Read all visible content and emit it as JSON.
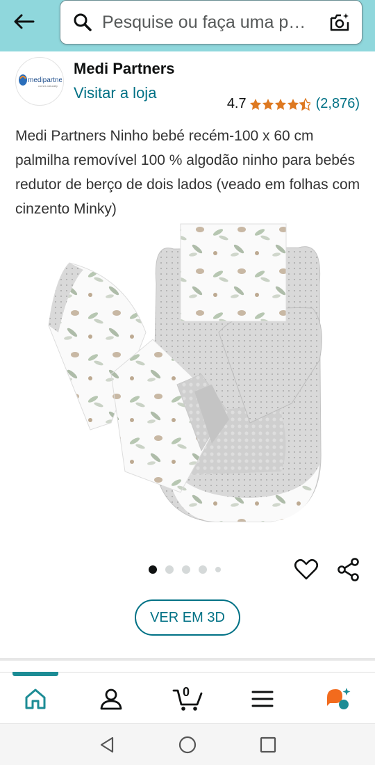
{
  "header": {
    "search_placeholder": "Pesquise ou faça uma pesquisa",
    "icons": [
      "back-arrow-icon",
      "search-icon",
      "camera-icon"
    ]
  },
  "store": {
    "logo_text": "medipartners",
    "logo_tagline": "comes naturally",
    "name": "Medi Partners",
    "visit_label": "Visitar a loja",
    "rating_value": "4.7",
    "rating_stars": 4.5,
    "rating_count": "(2,876)"
  },
  "product": {
    "title": "Medi Partners Ninho bebé recém-100 x 60 cm palmilha removível 100 % algodão ninho para bebés redutor de berço de dois lados (veado em folhas com cinzento Minky)"
  },
  "gallery": {
    "total_dots": 5,
    "active_index": 0
  },
  "actions": {
    "view3d_label": "VER EM 3D",
    "icons": [
      "heart-icon",
      "share-icon"
    ]
  },
  "bottom_nav": {
    "active": "home",
    "cart_count": "0",
    "items": [
      "home",
      "account",
      "cart",
      "menu",
      "rufus"
    ]
  },
  "colors": {
    "header_bg": "#8fd7dc",
    "link": "#007185",
    "star": "#de7921",
    "active_nav": "#1c8c95"
  }
}
